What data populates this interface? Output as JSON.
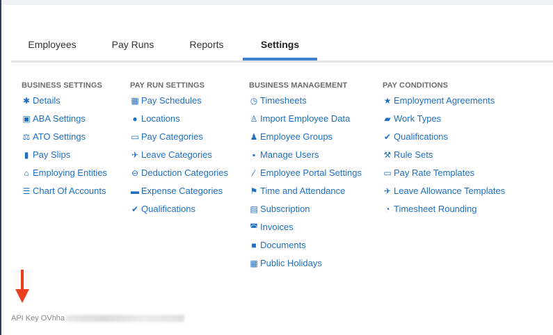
{
  "tabs": [
    {
      "label": "Employees",
      "active": false
    },
    {
      "label": "Pay Runs",
      "active": false
    },
    {
      "label": "Reports",
      "active": false
    },
    {
      "label": "Settings",
      "active": true
    }
  ],
  "columns": [
    {
      "heading": "BUSINESS SETTINGS",
      "items": [
        {
          "icon": "gear-icon",
          "label": "Details"
        },
        {
          "icon": "floppy-icon",
          "label": "ABA Settings"
        },
        {
          "icon": "scales-icon",
          "label": "ATO Settings"
        },
        {
          "icon": "file-icon",
          "label": "Pay Slips"
        },
        {
          "icon": "bank-icon",
          "label": "Employing Entities"
        },
        {
          "icon": "list-icon",
          "label": "Chart Of Accounts"
        }
      ]
    },
    {
      "heading": "PAY RUN SETTINGS",
      "items": [
        {
          "icon": "calendar-icon",
          "label": "Pay Schedules"
        },
        {
          "icon": "globe-icon",
          "label": "Locations"
        },
        {
          "icon": "money-icon",
          "label": "Pay Categories"
        },
        {
          "icon": "plane-icon",
          "label": "Leave Categories"
        },
        {
          "icon": "minus-circle-icon",
          "label": "Deduction Categories"
        },
        {
          "icon": "archive-icon",
          "label": "Expense Categories"
        },
        {
          "icon": "check-icon",
          "label": "Qualifications"
        }
      ]
    },
    {
      "heading": "BUSINESS MANAGEMENT",
      "items": [
        {
          "icon": "clock-icon",
          "label": "Timesheets"
        },
        {
          "icon": "users-pair-icon",
          "label": "Import Employee Data"
        },
        {
          "icon": "group-icon",
          "label": "Employee Groups"
        },
        {
          "icon": "lock-icon",
          "label": "Manage Users"
        },
        {
          "icon": "wand-icon",
          "label": "Employee Portal Settings"
        },
        {
          "icon": "flag-icon",
          "label": "Time and Attendance"
        },
        {
          "icon": "credit-card-icon",
          "label": "Subscription"
        },
        {
          "icon": "inbox-icon",
          "label": "Invoices"
        },
        {
          "icon": "folder-icon",
          "label": "Documents"
        },
        {
          "icon": "calendar-icon",
          "label": "Public Holidays"
        }
      ]
    },
    {
      "heading": "PAY CONDITIONS",
      "items": [
        {
          "icon": "star-icon",
          "label": "Employment Agreements"
        },
        {
          "icon": "book-icon",
          "label": "Work Types"
        },
        {
          "icon": "check-icon",
          "label": "Qualifications"
        },
        {
          "icon": "gavel-icon",
          "label": "Rule Sets"
        },
        {
          "icon": "money-icon",
          "label": "Pay Rate Templates"
        },
        {
          "icon": "plane-icon",
          "label": "Leave Allowance Templates"
        },
        {
          "icon": "clock-outline-icon",
          "label": "Timesheet Rounding"
        }
      ]
    }
  ],
  "footer": {
    "api_key_label": "API Key OVhha"
  },
  "colors": {
    "link": "#1f6fc0",
    "accent": "#3b82d4",
    "arrow": "#e8401c"
  }
}
